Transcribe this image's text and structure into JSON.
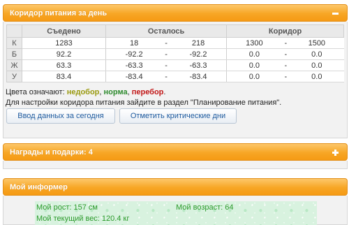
{
  "corridor_panel": {
    "title": "Коридор питания за день",
    "table": {
      "headers": {
        "eaten": "Съедено",
        "remaining": "Осталось",
        "corridor": "Коридор"
      },
      "rows": [
        {
          "label": "К",
          "eaten": "1283",
          "eaten_status": "under",
          "rem_min": "18",
          "rem_dash": "-",
          "rem_max": "218",
          "cor_min": "1300",
          "cor_dash": "-",
          "cor_max": "1500"
        },
        {
          "label": "Б",
          "eaten": "92.2",
          "eaten_status": "over",
          "rem_min": "-92.2",
          "rem_dash": "-",
          "rem_max": "-92.2",
          "cor_min": "0.0",
          "cor_dash": "-",
          "cor_max": "0.0"
        },
        {
          "label": "Ж",
          "eaten": "63.3",
          "eaten_status": "over",
          "rem_min": "-63.3",
          "rem_dash": "-",
          "rem_max": "-63.3",
          "cor_min": "0.0",
          "cor_dash": "-",
          "cor_max": "0.0"
        },
        {
          "label": "У",
          "eaten": "83.4",
          "eaten_status": "over",
          "rem_min": "-83.4",
          "rem_dash": "-",
          "rem_max": "-83.4",
          "cor_min": "0.0",
          "cor_dash": "-",
          "cor_max": "0.0"
        }
      ]
    },
    "legend": {
      "prefix": "Цвета означают:",
      "under": "недобор",
      "sep1": ",",
      "norm": "норма",
      "sep2": ",",
      "over": "перебор",
      "suffix": "."
    },
    "settings_note": "Для настройки коридора питания зайдите в раздел \"Планирование питания\".",
    "buttons": {
      "enter_data": "Ввод данных за сегодня",
      "mark_critical": "Отметить критические дни"
    }
  },
  "rewards_panel": {
    "title": "Награды и подарки: 4"
  },
  "informer_panel": {
    "title": "Мой информер",
    "height": "Мой рост: 157 см",
    "age": "Мой возраст: 64",
    "weight": "Мой текущий вес: 120.4 кг"
  },
  "colors": {
    "under": "#9a9a10",
    "norm": "#2e8b2e",
    "over": "#c21818",
    "header": "#f7a625",
    "link": "#1d5a9e"
  }
}
